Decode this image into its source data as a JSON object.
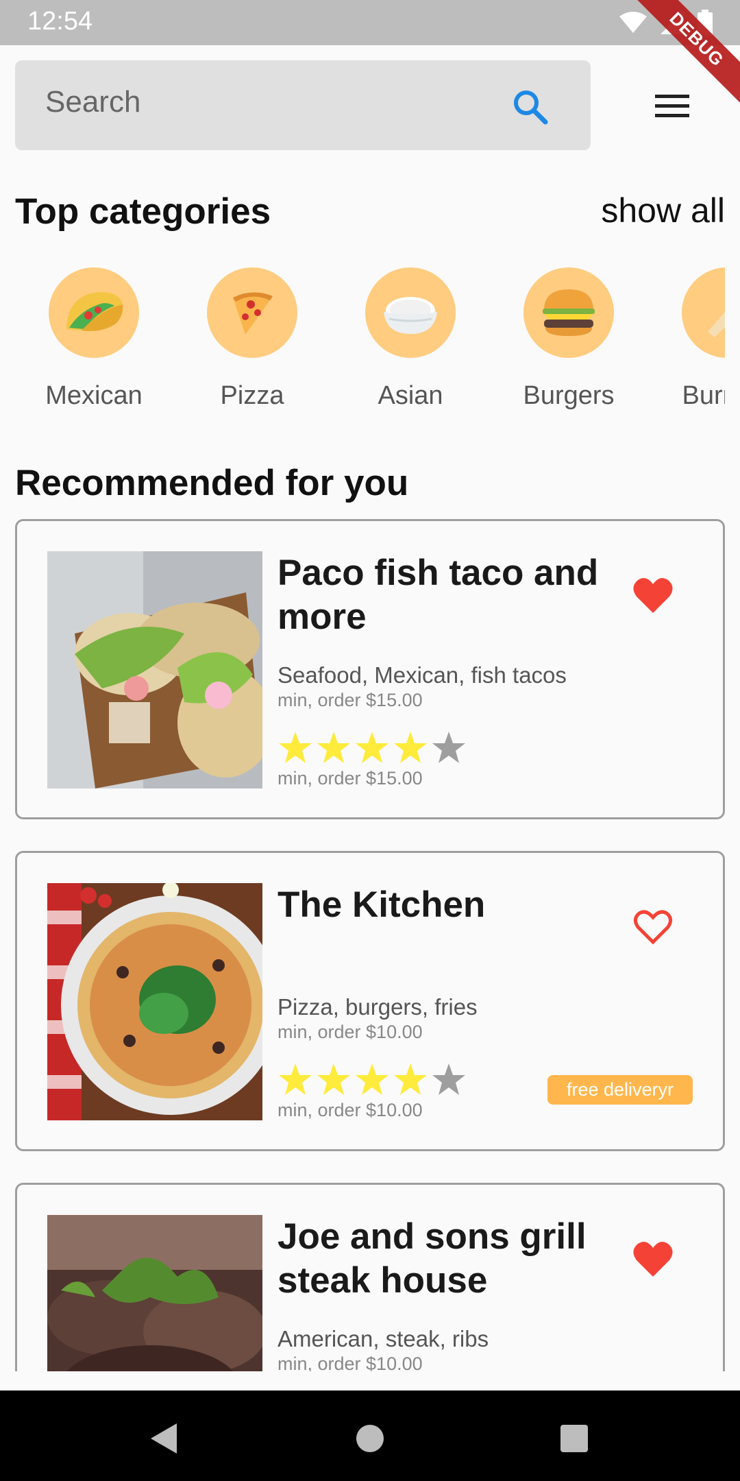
{
  "status_bar": {
    "time": "12:54",
    "debug_label": "DEBUG"
  },
  "search": {
    "placeholder": "Search"
  },
  "categories_section": {
    "title": "Top categories",
    "show_all": "show all",
    "items": [
      {
        "label": "Mexican",
        "icon": "taco-icon"
      },
      {
        "label": "Pizza",
        "icon": "pizza-icon"
      },
      {
        "label": "Asian",
        "icon": "rice-bowl-icon"
      },
      {
        "label": "Burgers",
        "icon": "burger-icon"
      },
      {
        "label": "Burritos",
        "icon": "burrito-icon"
      }
    ]
  },
  "recommended": {
    "title": "Recommended for you",
    "restaurants": [
      {
        "name": "Paco fish taco and more",
        "tags": "Seafood, Mexican, fish tacos",
        "min_order_1": "min, order $15.00",
        "min_order_2": "min, order $15.00",
        "rating": 4,
        "max_rating": 5,
        "favorite": true,
        "badge": null
      },
      {
        "name": "The Kitchen",
        "tags": "Pizza, burgers, fries",
        "min_order_1": "min, order $10.00",
        "min_order_2": "min, order $10.00",
        "rating": 4,
        "max_rating": 5,
        "favorite": false,
        "badge": "free deliveryr"
      },
      {
        "name": "Joe and sons grill steak house",
        "tags": "American, steak, ribs",
        "min_order_1": "min, order $10.00",
        "favorite": true
      }
    ]
  },
  "colors": {
    "accent_search": "#1e88e5",
    "heart": "#f44336",
    "star_on": "#ffeb3b",
    "star_off": "#9e9e9e",
    "category_bg": "#ffcc80",
    "badge_bg": "#ffb74d"
  }
}
